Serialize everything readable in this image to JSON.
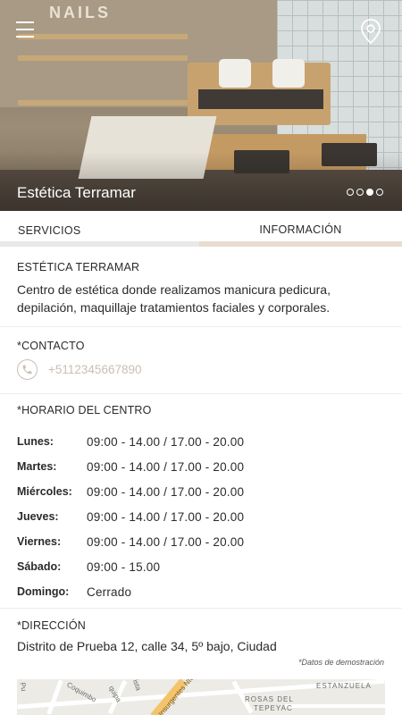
{
  "hero": {
    "sign_text": "NAILS",
    "title": "Estética Terramar",
    "slides_count": 4,
    "active_slide": 3
  },
  "tabs": [
    {
      "label": "SERVICIOS",
      "active": false
    },
    {
      "label": "INFORMACIÓN",
      "active": true
    }
  ],
  "about": {
    "title": "ESTÉTICA TERRAMAR",
    "description": "Centro de estética donde realizamos manicura pedicura, depilación, maquillaje tratamientos faciales y corporales."
  },
  "contact": {
    "title": "*CONTACTO",
    "phone": "+5112345667890",
    "icon": "phone-icon"
  },
  "schedule": {
    "title": "*HORARIO DEL CENTRO",
    "rows": [
      {
        "day": "Lunes:",
        "hours": "09:00 - 14.00  /  17.00 - 20.00"
      },
      {
        "day": "Martes:",
        "hours": "09:00 - 14.00  /  17.00 - 20.00"
      },
      {
        "day": "Miércoles:",
        "hours": "09:00 - 14.00  /  17.00 - 20.00"
      },
      {
        "day": "Jueves:",
        "hours": "09:00 - 14.00  /  17.00 - 20.00"
      },
      {
        "day": "Viernes:",
        "hours": "09:00 - 14.00  /  17.00 - 20.00"
      },
      {
        "day": "Sábado:",
        "hours": "09:00 - 15.00"
      },
      {
        "day": "Domingo:",
        "hours": "Cerrado"
      }
    ]
  },
  "address": {
    "title": "*DIRECCIÓN",
    "text": "Distrito de Prueba 12, calle 34, 5º bajo, Ciudad",
    "note": "*Datos de demostración"
  },
  "map": {
    "labels": [
      "Coquimbo",
      "Pu",
      "quipa",
      "ista",
      "Insurgentes Nte",
      "ROSAS DEL",
      "TEPEYAC",
      "ESTANZUELA"
    ]
  },
  "colors": {
    "accent": "#e9ddd0",
    "muted_text": "#c9bfb3",
    "text": "#2a2a2a"
  }
}
